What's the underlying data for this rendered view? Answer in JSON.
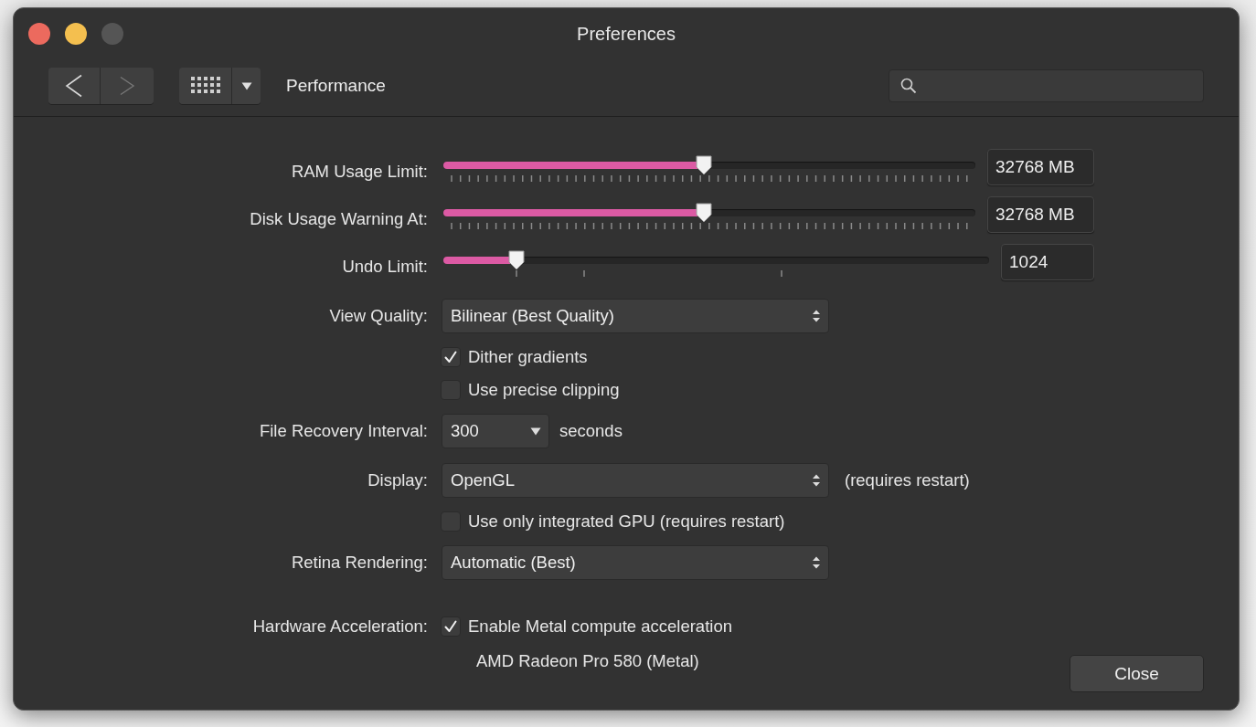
{
  "window": {
    "title": "Preferences"
  },
  "toolbar": {
    "section": "Performance"
  },
  "settings": [
    {
      "kind": "ticked_slider",
      "label": "RAM Usage Limit:",
      "level": 0.49,
      "value": "32768 MB"
    },
    {
      "kind": "ticked_slider",
      "label": "Disk Usage Warning At:",
      "level": 0.49,
      "value": "32768 MB"
    },
    {
      "kind": "slider",
      "label": "Undo Limit:",
      "level": 0.134,
      "value": "1024"
    },
    {
      "kind": "popup",
      "label": "View Quality:",
      "value": "Bilinear (Best Quality)"
    },
    {
      "kind": "checkbox",
      "text": "Dither gradients",
      "checked": true
    },
    {
      "kind": "checkbox",
      "text": "Use precise clipping",
      "checked": false
    },
    {
      "kind": "dropdown",
      "label": "File Recovery Interval:",
      "value": "300",
      "suffix": "seconds"
    },
    {
      "kind": "popup",
      "label": "Display:",
      "value": "OpenGL",
      "note": "(requires restart)"
    },
    {
      "kind": "checkbox",
      "text": "Use only integrated GPU (requires restart)",
      "checked": false
    },
    {
      "kind": "popup",
      "label": "Retina Rendering:",
      "value": "Automatic (Best)"
    },
    {
      "kind": "checkbox",
      "label": "Hardware Acceleration:",
      "text": "Enable Metal compute acceleration",
      "checked": true
    },
    {
      "kind": "info",
      "text": "AMD Radeon Pro 580 (Metal)"
    }
  ],
  "buttons": [
    {
      "label": "Close"
    }
  ]
}
